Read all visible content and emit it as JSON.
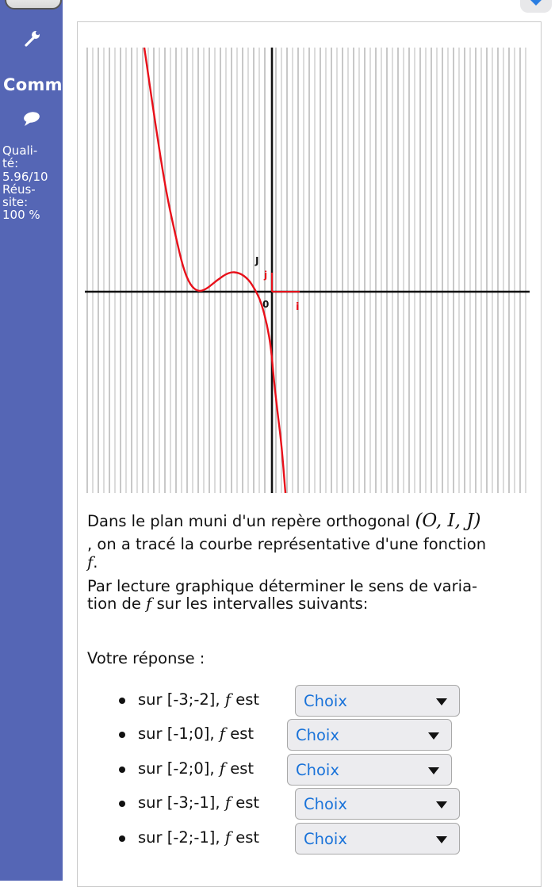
{
  "sidebar": {
    "comm_label": "Comm",
    "stats_lines": [
      "Quali-",
      "té:",
      "5.96/10",
      "Réus-",
      "site:",
      "100 %"
    ]
  },
  "graph": {
    "label_J": "J",
    "label_j": "j",
    "label_O": "0",
    "label_i": "i",
    "colors": {
      "curve": "#e8101a",
      "axes": "#111111",
      "grid": "#b0b0b0"
    }
  },
  "problem": {
    "line1": "Dans le plan muni d'un repère orthogonal",
    "math_repere": "(O, I, J)",
    "line2": ", on a tracé la courbe représentative d'une fonction",
    "math_f": "f",
    "dot": ".",
    "line3a": "Par lecture graphique déterminer le sens de varia-",
    "line3b_prefix": "tion de",
    "line3b_suffix": "sur les intervalles suivants:"
  },
  "answer": {
    "heading": "Votre réponse :",
    "rows": [
      {
        "prefix": "sur [-3;-2],",
        "f": "f",
        "suffix": "est",
        "select": "Choix"
      },
      {
        "prefix": "sur [-1;0],",
        "f": "f",
        "suffix": "est",
        "select": "Choix"
      },
      {
        "prefix": "sur [-2;0],",
        "f": "f",
        "suffix": "est",
        "select": "Choix"
      },
      {
        "prefix": "sur [-3;-1],",
        "f": "f",
        "suffix": "est",
        "select": "Choix"
      },
      {
        "prefix": "sur [-2;-1],",
        "f": "f",
        "suffix": "est",
        "select": "Choix"
      }
    ]
  }
}
